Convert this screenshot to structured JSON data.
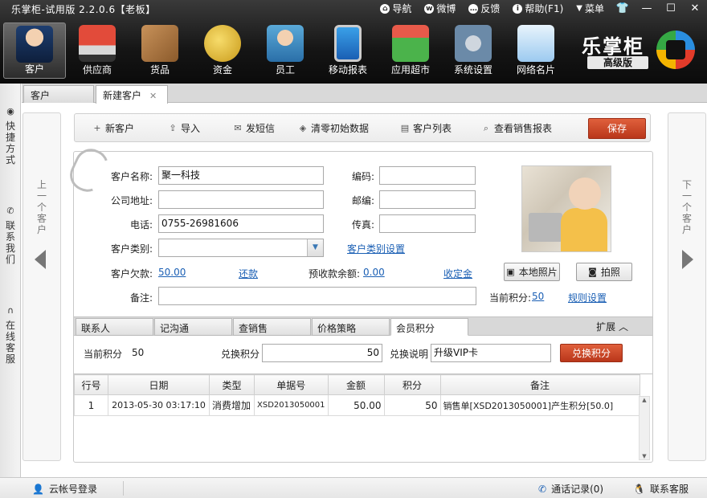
{
  "app": {
    "title": "乐掌柜-试用版 2.2.0.6【老板】"
  },
  "top_menu": [
    {
      "label": "导航",
      "icon": "home-icon"
    },
    {
      "label": "微博",
      "icon": "weibo-icon"
    },
    {
      "label": "反馈",
      "icon": "feedback-icon"
    },
    {
      "label": "帮助(F1)",
      "icon": "help-icon"
    },
    {
      "label": "菜单",
      "icon": "menu-icon"
    }
  ],
  "toolbar": [
    {
      "label": "客户",
      "icon": "customer-icon",
      "active": true
    },
    {
      "label": "供应商",
      "icon": "supplier-bus-icon"
    },
    {
      "label": "货品",
      "icon": "goods-box-icon"
    },
    {
      "label": "资金",
      "icon": "money-bag-icon"
    },
    {
      "label": "员工",
      "icon": "employee-icon"
    },
    {
      "label": "移动报表",
      "icon": "mobile-report-icon"
    },
    {
      "label": "应用超市",
      "icon": "shopping-cart-icon"
    },
    {
      "label": "系统设置",
      "icon": "settings-gear-icon"
    },
    {
      "label": "网络名片",
      "icon": "business-card-icon"
    }
  ],
  "brand": {
    "name": "乐掌柜",
    "edition": "高级版"
  },
  "sidebar": [
    {
      "label": "快捷方式"
    },
    {
      "label": "联系我们"
    },
    {
      "label": "在线客服"
    }
  ],
  "tabs": [
    {
      "label": "客户"
    },
    {
      "label": "新建客户"
    }
  ],
  "nav": {
    "prev": "上一个客户",
    "next": "下一个客户"
  },
  "actions": {
    "new": "新客户",
    "import": "导入",
    "sms": "发短信",
    "clear": "清零初始数据",
    "list": "客户列表",
    "report": "查看销售报表",
    "save": "保存"
  },
  "form": {
    "name_label": "客户名称:",
    "name": "聚一科技",
    "code_label": "编码:",
    "code": "",
    "address_label": "公司地址:",
    "address": "",
    "zip_label": "邮编:",
    "zip": "",
    "phone_label": "电话:",
    "phone": "0755-26981606",
    "fax_label": "传真:",
    "fax": "",
    "category_label": "客户类别:",
    "category": "",
    "category_setting": "客户类别设置",
    "debt_label": "客户欠款:",
    "debt": "50.00",
    "repay": "还款",
    "prepaid_label": "预收款余额:",
    "prepaid": "0.00",
    "collect": "收定金",
    "notes_label": "备注:",
    "notes": "",
    "points_label": "当前积分:",
    "points": "50",
    "rules": "规则设置",
    "local_photo": "本地照片",
    "take_photo": "拍照"
  },
  "subtabs": [
    {
      "label": "联系人"
    },
    {
      "label": "记沟通"
    },
    {
      "label": "查销售"
    },
    {
      "label": "价格策略"
    },
    {
      "label": "会员积分"
    }
  ],
  "expand_label": "扩展",
  "points_panel": {
    "current_label": "当前积分",
    "current": "50",
    "exchange_label": "兑换积分",
    "exchange": "50",
    "desc_label": "兑换说明",
    "desc": "升级VIP卡",
    "button": "兑换积分"
  },
  "table": {
    "headers": [
      "行号",
      "日期",
      "类型",
      "单据号",
      "金额",
      "积分",
      "备注"
    ],
    "rows": [
      [
        "1",
        "2013-05-30 03:17:10",
        "消费增加",
        "XSD2013050001",
        "50.00",
        "50",
        "销售单[XSD2013050001]产生积分[50.0]"
      ]
    ]
  },
  "statusbar": {
    "cloud_login": "云帐号登录",
    "call_log": "通话记录(0)",
    "contact_service": "联系客服"
  }
}
